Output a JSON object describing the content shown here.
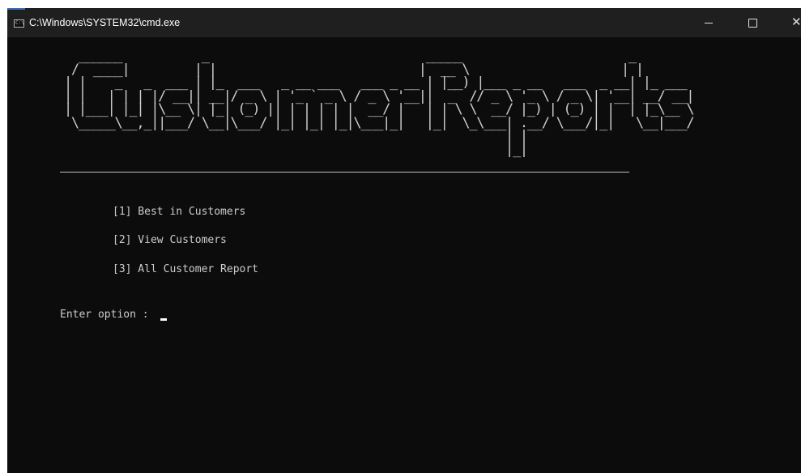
{
  "window": {
    "title": "C:\\Windows\\SYSTEM32\\cmd.exe",
    "icon": "cmd-icon",
    "icon_text": "C:\\",
    "controls": {
      "minimize": "—",
      "maximize": "□",
      "close": "✕"
    }
  },
  "console": {
    "banner_ascii": "  ______           _                              _____                       _\n /  ____|         | |                            |  __ \\                     | |\n| |    _   _  ___ | |_  ___   _ __ ___   ___ _ __ | |__) |___ _ __   ___  _ __| |_ ___\n| |   | | | |/ __|| __|/ _ \\ | '_ ` _ \\ / _ \\ '__||  _  // _ \\ '_ \\ / _ \\| '__| __/ __|\n| |___| |_| |\\__ \\| |_| (_) || | | | | |  __/ |   | | \\ \\  __/ |_) | (_) | |  | |_\\__ \\\n \\_____\\__,_||___/ \\__|\\___/ |_| |_| |_|\\___|_|   |_|  \\_\\___| .__/ \\___/|_|   \\__|___/\n                                                             | |\n                                                             |_|",
    "menu": [
      "[1] Best in Customers",
      "[2] View Customers",
      "[3] All Customer Report"
    ],
    "prompt": "Enter option : "
  },
  "colors": {
    "background": "#0c0c0c",
    "titlebar": "#1f1f1f",
    "text": "#cccccc",
    "accent": "#3b6fb6"
  }
}
